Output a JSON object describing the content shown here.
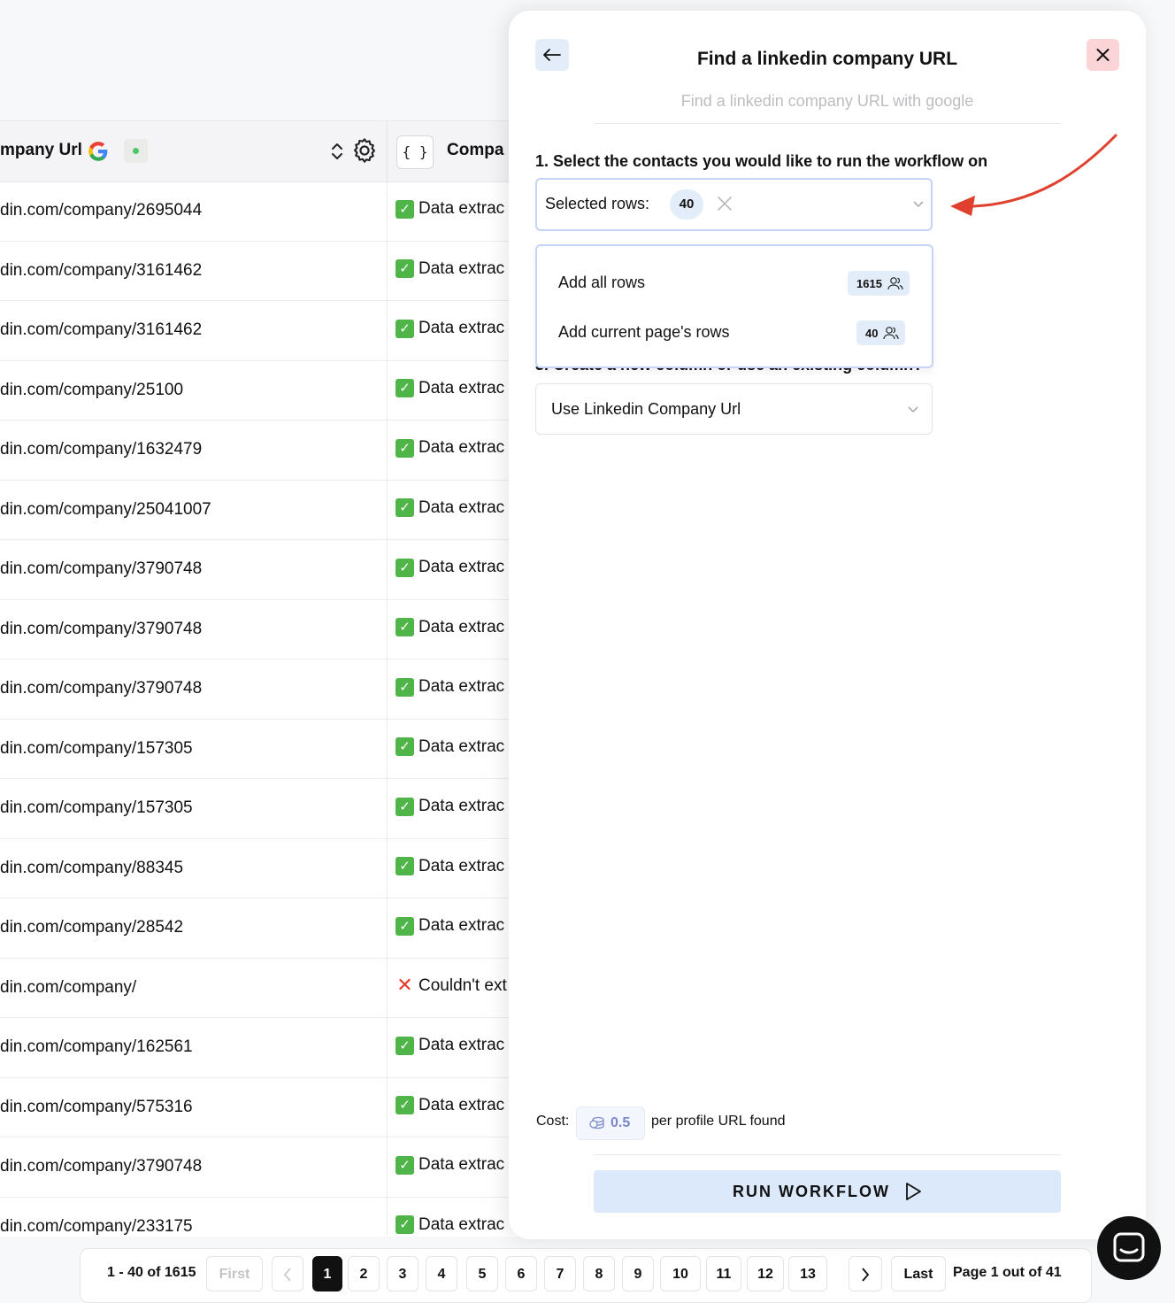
{
  "table": {
    "col1_header": "mpany Url",
    "col2_header": "Compa",
    "braces_label": "{ }",
    "rows": [
      {
        "url": "din.com/company/2695044",
        "status": "Data extrac",
        "ok": true
      },
      {
        "url": "din.com/company/3161462",
        "status": "Data extrac",
        "ok": true
      },
      {
        "url": "din.com/company/3161462",
        "status": "Data extrac",
        "ok": true
      },
      {
        "url": "din.com/company/25100",
        "status": "Data extrac",
        "ok": true
      },
      {
        "url": "din.com/company/1632479",
        "status": "Data extrac",
        "ok": true
      },
      {
        "url": "din.com/company/25041007",
        "status": "Data extrac",
        "ok": true
      },
      {
        "url": "din.com/company/3790748",
        "status": "Data extrac",
        "ok": true
      },
      {
        "url": "din.com/company/3790748",
        "status": "Data extrac",
        "ok": true
      },
      {
        "url": "din.com/company/3790748",
        "status": "Data extrac",
        "ok": true
      },
      {
        "url": "din.com/company/157305",
        "status": "Data extrac",
        "ok": true
      },
      {
        "url": "din.com/company/157305",
        "status": "Data extrac",
        "ok": true
      },
      {
        "url": "din.com/company/88345",
        "status": "Data extrac",
        "ok": true
      },
      {
        "url": "din.com/company/28542",
        "status": "Data extrac",
        "ok": true
      },
      {
        "url": "din.com/company/",
        "status": "Couldn't ext",
        "ok": false
      },
      {
        "url": "din.com/company/162561",
        "status": "Data extrac",
        "ok": true
      },
      {
        "url": "din.com/company/575316",
        "status": "Data extrac",
        "ok": true
      },
      {
        "url": "din.com/company/3790748",
        "status": "Data extrac",
        "ok": true
      },
      {
        "url": "din.com/company/233175",
        "status": "Data extrac",
        "ok": true
      }
    ]
  },
  "pagination": {
    "range": "1 - 40 of 1615",
    "first": "First",
    "pages": [
      "1",
      "2",
      "3",
      "4",
      "5",
      "6",
      "7",
      "8",
      "9",
      "10",
      "11",
      "12",
      "13"
    ],
    "current": "1",
    "last": "Last",
    "status": "Page 1 out of 41"
  },
  "panel": {
    "title": "Find a linkedin company URL",
    "subtitle": "Find a linkedin company URL with google",
    "step1": "1. Select the contacts you would like to run the workflow on",
    "selected_label": "Selected rows:",
    "selected_count": "40",
    "dropdown": [
      {
        "label": "Add all rows",
        "count": "1615"
      },
      {
        "label": "Add current page's rows",
        "count": "40"
      }
    ],
    "step3": "3. Create a new column or use an existing column?",
    "column_value": "Use Linkedin Company Url",
    "cost_label": "Cost:",
    "cost_value": "0.5",
    "cost_suffix": "per profile URL found",
    "run_label": "RUN WORKFLOW"
  },
  "colors": {
    "accent_light": "#dce9fb",
    "close_bg": "#fbd4d8",
    "annotation_arrow": "#e0402e",
    "success": "#4fb548",
    "error": "#e23b2f"
  }
}
